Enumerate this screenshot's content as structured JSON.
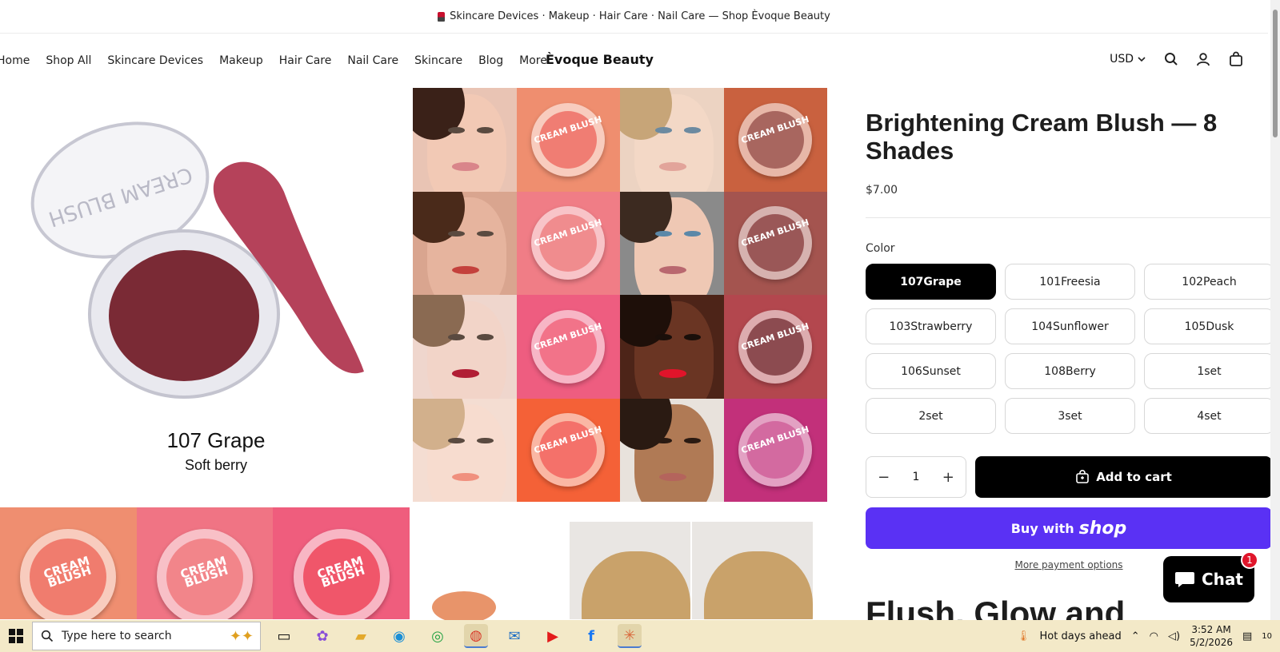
{
  "announcement": "Skincare Devices · Makeup · Hair Care · Nail Care — Shop Èvoque Beauty",
  "nav": {
    "items": [
      "Home",
      "Shop All",
      "Skincare Devices",
      "Makeup",
      "Hair Care",
      "Nail Care",
      "Skincare",
      "Blog",
      "More"
    ],
    "brand": "Èvoque Beauty",
    "currency": "USD"
  },
  "main_image": {
    "product_lid_text": "CREAM BLUSH",
    "caption_title": "107 Grape",
    "caption_sub": "Soft berry"
  },
  "grid": {
    "compact_label": "CREAM BLUSH"
  },
  "product": {
    "title": "Brightening Cream Blush — 8 Shades",
    "price": "$7.00",
    "color_label": "Color",
    "shades": [
      "107Grape",
      "101Freesia",
      "102Peach",
      "103Strawberry",
      "104Sunflower",
      "105Dusk",
      "106Sunset",
      "108Berry",
      "1set",
      "2set",
      "3set",
      "4set"
    ],
    "selected_shade": "107Grape",
    "quantity": "1",
    "add_to_cart": "Add to cart",
    "buy_with": "Buy with",
    "shop_word": "shop",
    "more_payment": "More payment options",
    "section_heading": "Flush, Glow and"
  },
  "chat": {
    "label": "Chat",
    "badge": "1"
  },
  "taskbar": {
    "search_placeholder": "Type here to search",
    "weather": "Hot days ahead",
    "time": "3:52 AM",
    "date": "5/2/2026",
    "notifications": "10"
  },
  "colors": {
    "shop_pay": "#5a31f4",
    "primary_button": "#000000",
    "chat_badge": "#e0162b"
  }
}
